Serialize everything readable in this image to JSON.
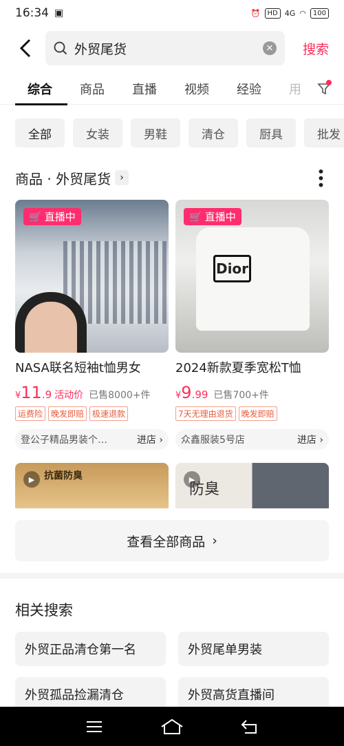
{
  "status": {
    "time": "16:34",
    "network": "4G",
    "battery": "100"
  },
  "search": {
    "query": "外贸尾货",
    "button": "搜索"
  },
  "tabs": [
    "综合",
    "商品",
    "直播",
    "视频",
    "经验",
    "用"
  ],
  "chips": [
    "全部",
    "女装",
    "男鞋",
    "清仓",
    "厨具",
    "批发"
  ],
  "section": {
    "title": "商品 · 外贸尾货"
  },
  "products": [
    {
      "live": "直播中",
      "title": "NASA联名短袖t恤男女",
      "currency": "¥",
      "price_int": "11",
      "price_dec": ".9",
      "price_note": "活动价",
      "sold": "已售8000+件",
      "tags": [
        "运费险",
        "晚发即赔",
        "极速退款"
      ],
      "shop": "登公子精品男装个…",
      "shop_action": "进店",
      "thumb_text": ""
    },
    {
      "live": "直播中",
      "title": "2024新款夏季宽松T恤",
      "currency": "¥",
      "price_int": "9",
      "price_dec": ".99",
      "price_note": "",
      "sold": "已售700+件",
      "tags": [
        "7天无理由退货",
        "晚发即赔"
      ],
      "shop": "众鑫服装5号店",
      "shop_action": "进店",
      "thumb_text": "Dior"
    }
  ],
  "row2": [
    {
      "text": "抗菌防臭"
    },
    {
      "text": "防臭"
    }
  ],
  "view_all": "查看全部商品",
  "related": {
    "title": "相关搜索",
    "items": [
      "外贸正品清仓第一名",
      "外贸尾单男装",
      "外贸孤品捡漏清仓",
      "外贸高货直播间"
    ]
  },
  "colors": {
    "accent": "#ff2d5a",
    "live": "#ff2d6f"
  }
}
